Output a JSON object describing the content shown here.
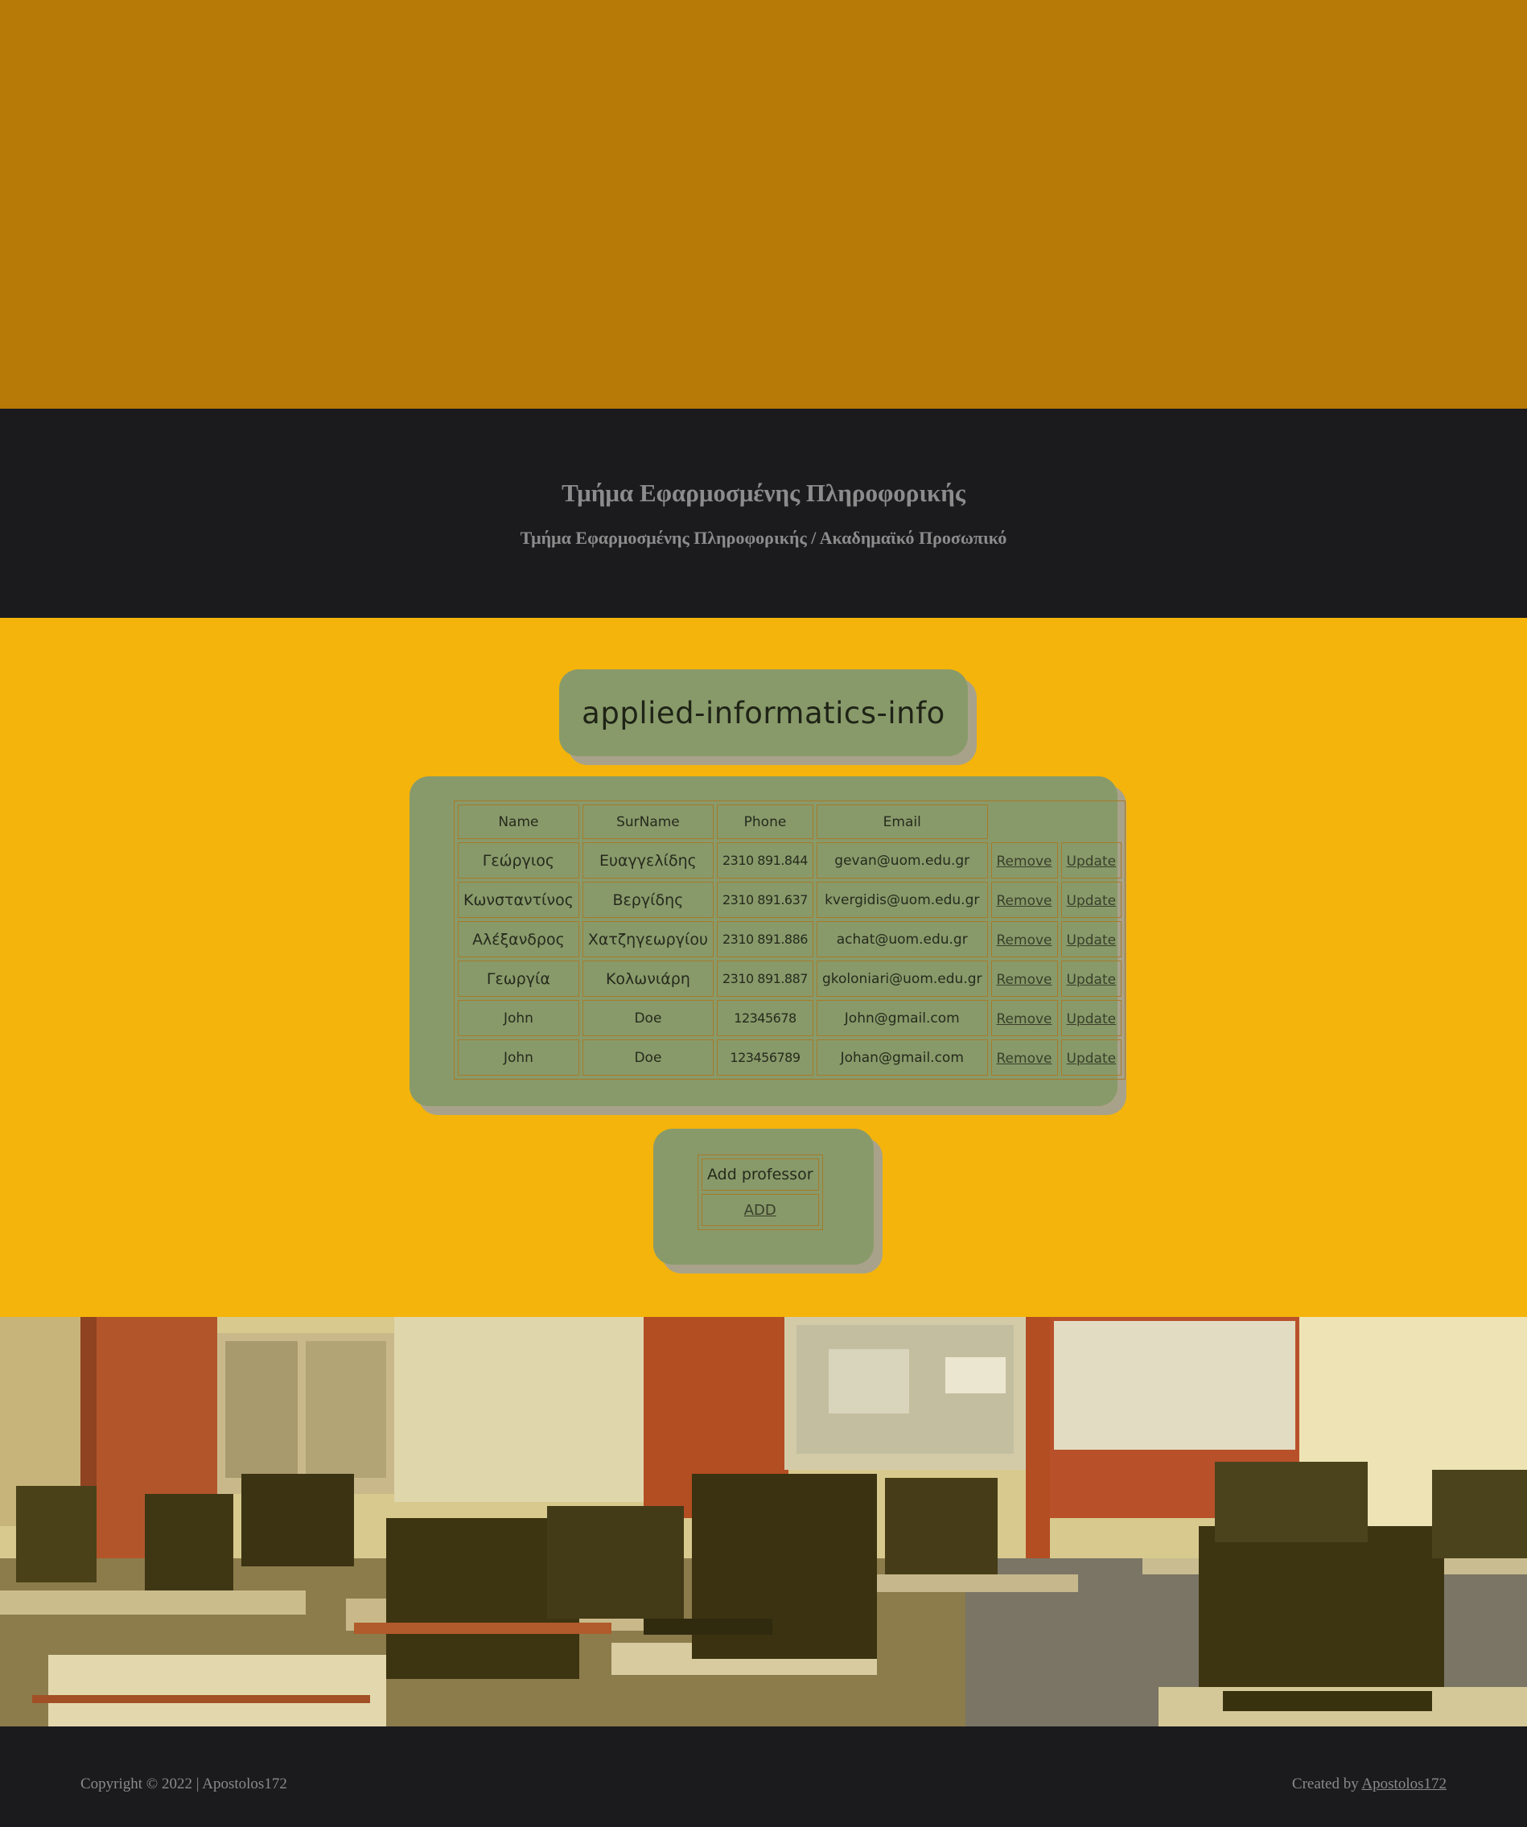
{
  "header": {
    "title": "Τμήμα Εφαρμοσμένης Πληροφορικής",
    "breadcrumb": "Τμήμα Εφαρμοσμένης Πληροφορικής / Ακαδημαϊκό Προσωπικό"
  },
  "main": {
    "heading": "applied-informatics-info",
    "table": {
      "columns": [
        "Name",
        "SurName",
        "Phone",
        "Email"
      ],
      "action_labels": {
        "remove": "Remove",
        "update": "Update"
      },
      "rows": [
        {
          "name": "Γεώργιος",
          "surname": "Ευαγγελίδης",
          "phone": "2310 891.844",
          "email": "gevan@uom.edu.gr"
        },
        {
          "name": "Κωνσταντίνος",
          "surname": "Βεργίδης",
          "phone": "2310 891.637",
          "email": "kvergidis@uom.edu.gr"
        },
        {
          "name": "Αλέξανδρος",
          "surname": "Χατζηγεωργίου",
          "phone": "2310 891.886",
          "email": "achat@uom.edu.gr"
        },
        {
          "name": "Γεωργία",
          "surname": "Κολωνιάρη",
          "phone": "2310 891.887",
          "email": "gkoloniari@uom.edu.gr"
        },
        {
          "name": "John",
          "surname": "Doe",
          "phone": "12345678",
          "email": "John@gmail.com"
        },
        {
          "name": "John",
          "surname": "Doe",
          "phone": "123456789",
          "email": "Johan@gmail.com"
        }
      ]
    },
    "add_section": {
      "label": "Add professor",
      "link": "ADD"
    }
  },
  "footer": {
    "copyright": "Copyright © 2022 | Apostolos172",
    "created_prefix": "Created by",
    "created_link": "Apostolos172"
  },
  "colors": {
    "top_band": "#b87a06",
    "dark": "#1b1b1e",
    "main_bg": "#f4b40b",
    "card": "#889a6a",
    "card_border": "#a77a29",
    "shadow": "#a9a28a"
  },
  "image": {
    "subject": "computer lab classroom photo"
  }
}
